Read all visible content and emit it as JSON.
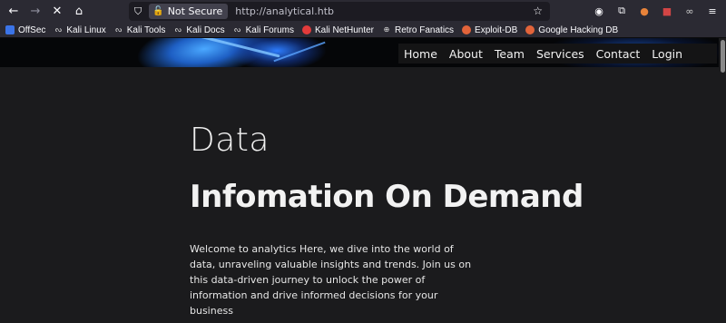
{
  "browser": {
    "url": "http://analytical.htb",
    "security_label": "Not Secure",
    "nav_icons": [
      "back-arrow-icon",
      "forward-arrow-icon",
      "stop-icon",
      "home-icon"
    ],
    "toolbar_icons": [
      "account-icon",
      "extensions-icon",
      "extension-fox-icon",
      "extension-badge-icon",
      "extension-glasses-icon",
      "menu-icon"
    ]
  },
  "bookmarks": [
    {
      "label": "OffSec",
      "icon": "offsec-icon",
      "color": "#3b74e8"
    },
    {
      "label": "Kali Linux",
      "icon": "kali-dragon-icon",
      "color": "#dddddd"
    },
    {
      "label": "Kali Tools",
      "icon": "kali-dragon-icon",
      "color": "#dddddd"
    },
    {
      "label": "Kali Docs",
      "icon": "kali-dragon-icon",
      "color": "#dddddd"
    },
    {
      "label": "Kali Forums",
      "icon": "kali-dragon-icon",
      "color": "#dddddd"
    },
    {
      "label": "Kali NetHunter",
      "icon": "nethunter-icon",
      "color": "#e23b3b"
    },
    {
      "label": "Retro Fanatics",
      "icon": "globe-icon",
      "color": "#dddddd"
    },
    {
      "label": "Exploit-DB",
      "icon": "exploitdb-icon",
      "color": "#e2643a"
    },
    {
      "label": "Google Hacking DB",
      "icon": "ghdb-icon",
      "color": "#e2643a"
    }
  ],
  "site": {
    "nav": [
      "Home",
      "About",
      "Team",
      "Services",
      "Contact",
      "Login"
    ],
    "heading_light": "Data",
    "heading_bold": "Infomation On Demand",
    "description": "Welcome to analytics Here, we dive into the world of data, unraveling valuable insights and trends. Join us on this data-driven journey to unlock the power of information and drive informed decisions for your business"
  }
}
